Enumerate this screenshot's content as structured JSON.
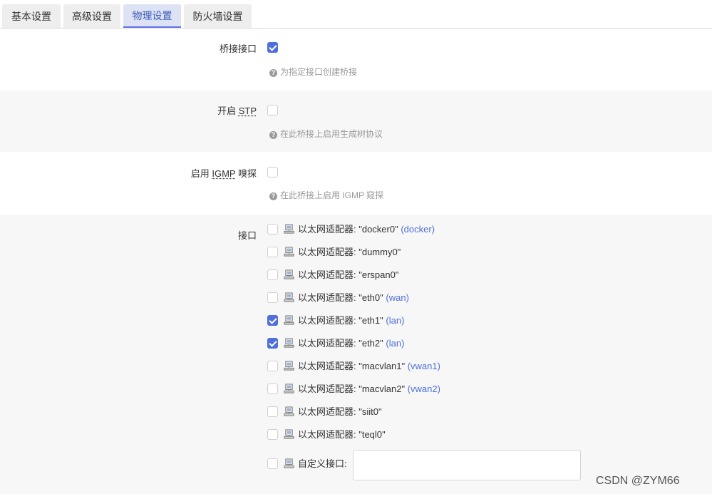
{
  "tabs": [
    {
      "label": "基本设置"
    },
    {
      "label": "高级设置"
    },
    {
      "label": "物理设置"
    },
    {
      "label": "防火墙设置"
    }
  ],
  "bridge": {
    "label": "桥接接口",
    "checked": true,
    "hint": "为指定接口创建桥接"
  },
  "stp": {
    "label_prefix": "开启 ",
    "abbr": "STP",
    "checked": false,
    "hint": "在此桥接上启用生成树协议"
  },
  "igmp": {
    "label_prefix": "启用 ",
    "abbr": "IGMP",
    "label_suffix": " 嗅探",
    "checked": false,
    "hint": "在此桥接上启用 IGMP 窥探"
  },
  "interfaces": {
    "label": "接口",
    "items": [
      {
        "text": "以太网适配器: \"docker0\"",
        "network": "(docker)",
        "checked": false
      },
      {
        "text": "以太网适配器: \"dummy0\"",
        "network": "",
        "checked": false
      },
      {
        "text": "以太网适配器: \"erspan0\"",
        "network": "",
        "checked": false
      },
      {
        "text": "以太网适配器: \"eth0\"",
        "network": "(wan)",
        "checked": false
      },
      {
        "text": "以太网适配器: \"eth1\"",
        "network": "(lan)",
        "checked": true
      },
      {
        "text": "以太网适配器: \"eth2\"",
        "network": "(lan)",
        "checked": true
      },
      {
        "text": "以太网适配器: \"macvlan1\"",
        "network": "(vwan1)",
        "checked": false
      },
      {
        "text": "以太网适配器: \"macvlan2\"",
        "network": "(vwan2)",
        "checked": false
      },
      {
        "text": "以太网适配器: \"siit0\"",
        "network": "",
        "checked": false
      },
      {
        "text": "以太网适配器: \"teql0\"",
        "network": "",
        "checked": false
      }
    ],
    "custom": {
      "label": "自定义接口:",
      "value": "",
      "checked": false
    }
  },
  "watermark": "CSDN @ZYM66",
  "colors": {
    "accent": "#4f6fd9",
    "alt_row": "#f7f7f7"
  }
}
